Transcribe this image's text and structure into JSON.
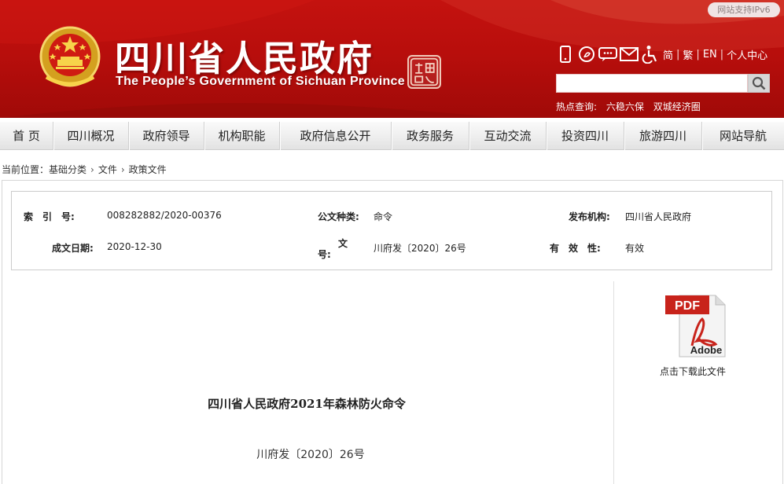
{
  "header": {
    "title_cn": "四川省人民政府",
    "title_en": "The People’s Government of Sichuan Province",
    "ipv6_badge": "网站支持IPv6",
    "lang": [
      "简",
      "繁",
      "EN",
      "个人中心"
    ],
    "search_placeholder": "",
    "hot_label": "热点查询:",
    "hot_links": [
      "六稳六保",
      "双城经济圈"
    ],
    "tool_icons": [
      "mobile-icon",
      "weibo-icon",
      "wechat-icon",
      "mail-icon",
      "accessibility-icon"
    ],
    "colors": {
      "banner_red": "#b80e0c",
      "accent_gold": "#f5c842"
    }
  },
  "nav": {
    "items": [
      "首 页",
      "四川概况",
      "政府领导",
      "机构职能",
      "政府信息公开",
      "政务服务",
      "互动交流",
      "投资四川",
      "旅游四川",
      "网站导航"
    ]
  },
  "breadcrumb": {
    "label": "当前位置：",
    "items": [
      "基础分类",
      "文件",
      "政策文件"
    ],
    "separator": "›"
  },
  "meta": {
    "index_label": "索　引　号:",
    "index_value": "008282882/2020-00376",
    "type_label": "公文种类:",
    "type_value": "命令",
    "issuer_label": "发布机构:",
    "issuer_value": "四川省人民政府",
    "date_label": "成文日期:",
    "date_value": "2020-12-30",
    "docno_label_top": "文",
    "docno_label_bottom": "号:",
    "docno_value": "川府发〔2020〕26号",
    "validity_label": "有　效　性:",
    "validity_value": "有效"
  },
  "attachment": {
    "icon_text": "PDF",
    "brand_text": "Adobe",
    "caption": "点击下载此文件"
  },
  "document": {
    "title": "四川省人民政府2021年森林防火命令",
    "number": "川府发〔2020〕26号"
  }
}
